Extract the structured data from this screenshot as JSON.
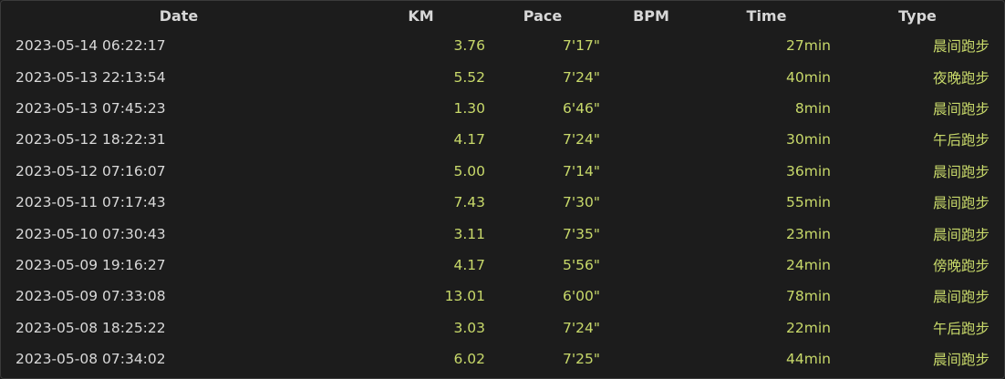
{
  "headers": {
    "date": "Date",
    "km": "KM",
    "pace": "Pace",
    "bpm": "BPM",
    "time": "Time",
    "type": "Type"
  },
  "rows": [
    {
      "date": "2023-05-14 06:22:17",
      "km": "3.76",
      "pace": "7'17\"",
      "bpm": "",
      "time": "27min",
      "type": "晨间跑步"
    },
    {
      "date": "2023-05-13 22:13:54",
      "km": "5.52",
      "pace": "7'24\"",
      "bpm": "",
      "time": "40min",
      "type": "夜晚跑步"
    },
    {
      "date": "2023-05-13 07:45:23",
      "km": "1.30",
      "pace": "6'46\"",
      "bpm": "",
      "time": "8min",
      "type": "晨间跑步"
    },
    {
      "date": "2023-05-12 18:22:31",
      "km": "4.17",
      "pace": "7'24\"",
      "bpm": "",
      "time": "30min",
      "type": "午后跑步"
    },
    {
      "date": "2023-05-12 07:16:07",
      "km": "5.00",
      "pace": "7'14\"",
      "bpm": "",
      "time": "36min",
      "type": "晨间跑步"
    },
    {
      "date": "2023-05-11 07:17:43",
      "km": "7.43",
      "pace": "7'30\"",
      "bpm": "",
      "time": "55min",
      "type": "晨间跑步"
    },
    {
      "date": "2023-05-10 07:30:43",
      "km": "3.11",
      "pace": "7'35\"",
      "bpm": "",
      "time": "23min",
      "type": "晨间跑步"
    },
    {
      "date": "2023-05-09 19:16:27",
      "km": "4.17",
      "pace": "5'56\"",
      "bpm": "",
      "time": "24min",
      "type": "傍晚跑步"
    },
    {
      "date": "2023-05-09 07:33:08",
      "km": "13.01",
      "pace": "6'00\"",
      "bpm": "",
      "time": "78min",
      "type": "晨间跑步"
    },
    {
      "date": "2023-05-08 18:25:22",
      "km": "3.03",
      "pace": "7'24\"",
      "bpm": "",
      "time": "22min",
      "type": "午后跑步"
    },
    {
      "date": "2023-05-08 07:34:02",
      "km": "6.02",
      "pace": "7'25\"",
      "bpm": "",
      "time": "44min",
      "type": "晨间跑步"
    }
  ],
  "colors": {
    "background": "#1c1c1c",
    "header_text": "#d7d7d7",
    "date_text": "#d9d9d9",
    "value_text": "#c8d96a",
    "border": "#3a3a3a"
  }
}
